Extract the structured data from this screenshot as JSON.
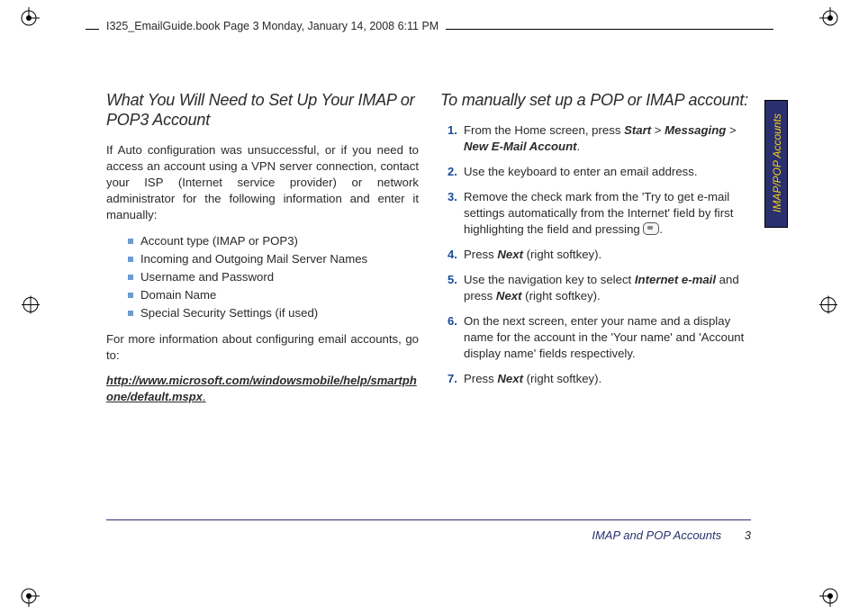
{
  "header": {
    "book_stamp": "I325_EmailGuide.book  Page 3  Monday, January 14, 2008  6:11 PM"
  },
  "tab": {
    "label": "IMAP/POP Accounts"
  },
  "left": {
    "heading": "What You Will Need to Set Up Your IMAP or POP3 Account",
    "intro": "If Auto configuration was unsuccessful, or if you need to access an account using a VPN server connection, contact your ISP (Internet service provider) or network administrator for the following information and enter it manually:",
    "items": [
      "Account type (IMAP or POP3)",
      "Incoming and Outgoing Mail Server Names",
      "Username and Password",
      "Domain Name",
      "Special Security Settings (if used)"
    ],
    "more_info": "For more information about configuring email accounts, go to:",
    "link_text": "http://www.microsoft.com/windowsmobile/help/smartphone/default.mspx",
    "link_suffix": "."
  },
  "right": {
    "heading": "To manually set up a POP or IMAP account:",
    "steps": {
      "s1a": "From the Home screen, press ",
      "s1b": "Start",
      "s1c": " > ",
      "s1d": "Messaging",
      "s1e": " > ",
      "s1f": "New E-Mail Account",
      "s1g": ".",
      "s2": "Use the keyboard to enter an email address.",
      "s3a": "Remove the check mark from the 'Try to get e-mail settings automatically from the Internet' field by first highlighting the field and pressing ",
      "s3b": ".",
      "s4a": "Press ",
      "s4b": "Next",
      "s4c": " (right softkey).",
      "s5a": "Use the navigation key to select ",
      "s5b": "Internet e-mail",
      "s5c": " and press ",
      "s5d": "Next",
      "s5e": " (right softkey).",
      "s6": "On the next screen, enter your name and a display name for the account in the 'Your name' and 'Account display name' fields respectively.",
      "s7a": "Press ",
      "s7b": "Next",
      "s7c": " (right softkey)."
    }
  },
  "footer": {
    "title": "IMAP and POP Accounts",
    "page": "3"
  }
}
